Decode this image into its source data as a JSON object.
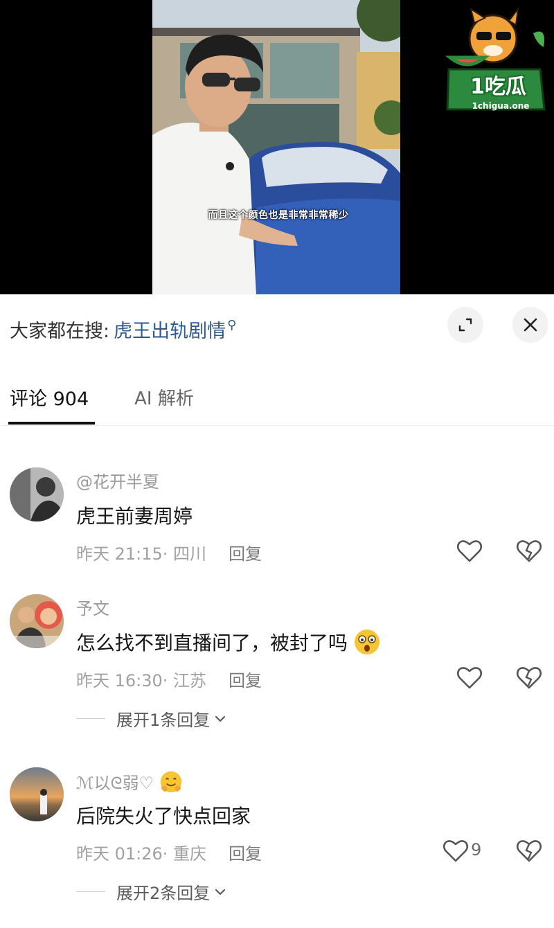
{
  "video": {
    "subtitle": "而且这个颜色也是非常非常稀少"
  },
  "watermark": {
    "brand": "1吃瓜",
    "domain": "1chigua.one"
  },
  "search_bar": {
    "prefix": "大家都在搜:",
    "term": "虎王出轨剧情",
    "icon": "search-icon"
  },
  "tabs": [
    {
      "label": "评论 904",
      "active": true
    },
    {
      "label": "AI 解析",
      "active": false
    }
  ],
  "comments": [
    {
      "username": "@花开半夏",
      "text": "虎王前妻周婷",
      "meta": "昨天 21:15· 四川",
      "reply_label": "回复",
      "like_count": "",
      "expand_label": ""
    },
    {
      "username": "予文",
      "text": "怎么找不到直播间了，被封了吗",
      "meta": "昨天 16:30· 江苏",
      "reply_label": "回复",
      "like_count": "",
      "expand_label": "展开1条回复"
    },
    {
      "username": "ℳ以ᘓ弱♡",
      "text": "后院失火了快点回家",
      "meta": "昨天 01:26· 重庆",
      "reply_label": "回复",
      "like_count": "9",
      "expand_label": "展开2条回复"
    }
  ],
  "colors": {
    "search_term": "#2f5a8f",
    "meta_text": "#a0a0a0",
    "tab_underline": "#111111"
  }
}
